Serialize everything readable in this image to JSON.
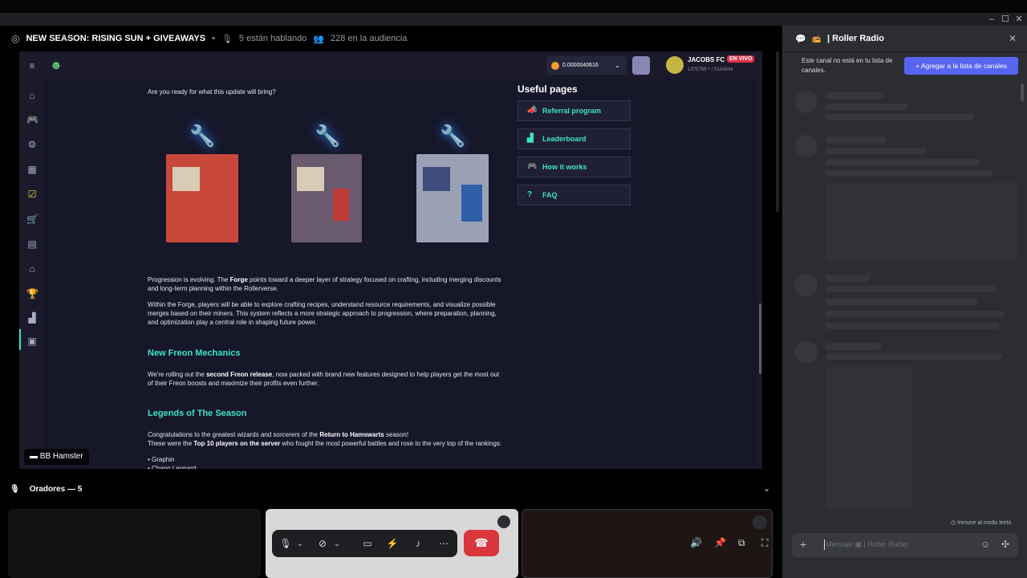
{
  "window": {
    "minimize": "–",
    "maximize": "☐",
    "close": "✕"
  },
  "stage": {
    "title": "NEW SEASON: RISING SUN + GIVEAWAYS",
    "speaking": "5 están hablando",
    "audience": "228 en la audiencia",
    "speakers_label": "Oradores — 5",
    "streamer_tag": "BB Hamster"
  },
  "site": {
    "balance": "0.0000040616",
    "user": {
      "name": "JACOBS FC",
      "stats": "1375769 ⁱⁿ / 5154844",
      "live_badge": "EN VIVO"
    },
    "intro": "Are you ready for what this update will bring?",
    "useful_pages": {
      "title": "Useful pages",
      "links": [
        "Referral program",
        "Leaderboard",
        "How it works",
        "FAQ"
      ]
    },
    "p1_a": "Progression is evolving. The ",
    "p1_b": "Forge",
    "p1_c": " points toward a deeper layer of strategy focused on crafting, including merging discounts and long-term planning within the Rollerverse.",
    "p2": "Within the Forge, players will be able to explore crafting recipes, understand resource requirements, and visualize possible merges based on their miners. This system reflects a more strategic approach to progression, where preparation, planning, and optimization play a central role in shaping future power.",
    "h_freon": "New Freon Mechanics",
    "p3_a": "We're rolling out the ",
    "p3_b": "second Freon release",
    "p3_c": ", now packed with brand new features designed to help players get the most out of their Freon boosts and maximize their profits even further.",
    "h_legends": "Legends of The Season",
    "p4_a": "Congratulations to the greatest wizards and sorcerers of the ",
    "p4_b": "Return to Hamswarts",
    "p4_c": " season!",
    "p5_a": "These were the ",
    "p5_b": "Top 10 players on the server",
    "p5_c": " who fought the most powerful battles and rose to the very top of the rankings:",
    "list": [
      "• Graphin",
      "• Chang Leonard"
    ]
  },
  "chat": {
    "title": "| Roller Radio",
    "notice": "Este canal no está en tu lista de canales.",
    "add_button": "+ Agregar a la lista de canales",
    "immune": "Inmune al modo lento",
    "placeholder": "Mensaje  ▣ | Roller Radio"
  },
  "colors": {
    "accent": "#3de5c1",
    "discord_blurple": "#5865f2",
    "hangup": "#da373c"
  }
}
